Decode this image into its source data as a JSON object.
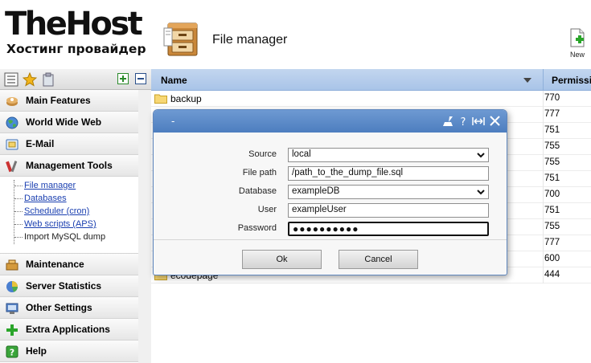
{
  "brand": {
    "name": "TheHost",
    "tagline": "Хостинг провайдер"
  },
  "header": {
    "module_title": "File manager",
    "new_label": "New"
  },
  "sidebar": {
    "sections": [
      {
        "label": "Main Features",
        "icon": "main-features-icon"
      },
      {
        "label": "World Wide Web",
        "icon": "globe-icon"
      },
      {
        "label": "E-Mail",
        "icon": "mail-icon"
      },
      {
        "label": "Management Tools",
        "icon": "tools-icon"
      }
    ],
    "submenu": [
      {
        "label": "File manager"
      },
      {
        "label": "Databases"
      },
      {
        "label": "Scheduler (cron)"
      },
      {
        "label": "Web scripts (APS)"
      },
      {
        "label": "Import MySQL dump"
      }
    ],
    "sections_bottom": [
      {
        "label": "Maintenance",
        "icon": "maintenance-icon"
      },
      {
        "label": "Server Statistics",
        "icon": "statistics-icon"
      },
      {
        "label": "Other Settings",
        "icon": "settings-icon"
      },
      {
        "label": "Extra Applications",
        "icon": "plus-icon"
      },
      {
        "label": "Help",
        "icon": "help-icon"
      }
    ]
  },
  "table": {
    "columns": {
      "name": "Name",
      "permissions": "Permissio"
    },
    "rows": [
      {
        "name": "backup",
        "perm": "770"
      },
      {
        "name": "",
        "perm": "777"
      },
      {
        "name": "",
        "perm": "751"
      },
      {
        "name": "",
        "perm": "755"
      },
      {
        "name": "",
        "perm": "755"
      },
      {
        "name": "",
        "perm": "751"
      },
      {
        "name": "",
        "perm": "700"
      },
      {
        "name": "",
        "perm": "751"
      },
      {
        "name": "",
        "perm": "755"
      },
      {
        "name": "",
        "perm": "777"
      },
      {
        "name": "",
        "perm": "600"
      },
      {
        "name": "ecodepage",
        "perm": "444"
      }
    ]
  },
  "dialog": {
    "title": "-",
    "fields": {
      "source": {
        "label": "Source",
        "value": "local"
      },
      "file_path": {
        "label": "File path",
        "value": "/path_to_the_dump_file.sql"
      },
      "database": {
        "label": "Database",
        "value": "exampleDB"
      },
      "user": {
        "label": "User",
        "value": "exampleUser"
      },
      "password": {
        "label": "Password",
        "value": "●●●●●●●●●●"
      }
    },
    "ok_label": "Ok",
    "cancel_label": "Cancel"
  },
  "colors": {
    "header_blue": "#a9c4e8",
    "dialog_title": "#4d7ebf",
    "link": "#1a3fb0"
  }
}
